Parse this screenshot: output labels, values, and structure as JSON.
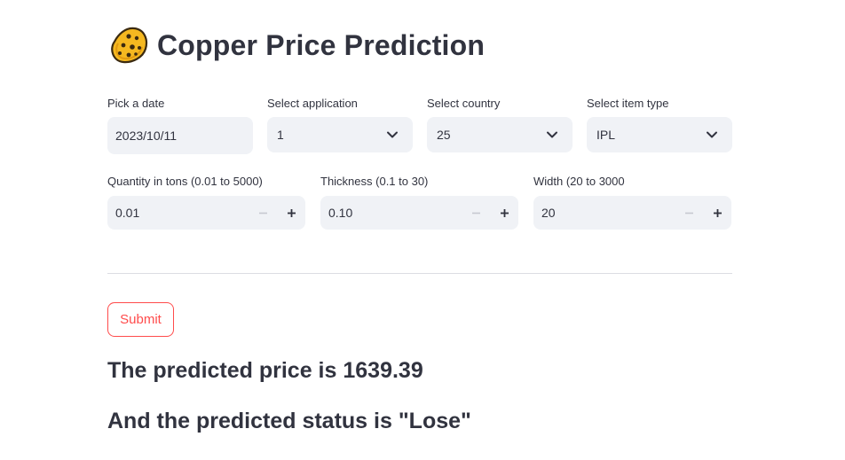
{
  "header": {
    "title": "Copper Price Prediction",
    "icon": "sponge-icon"
  },
  "form": {
    "date": {
      "label": "Pick a date",
      "value": "2023/10/11"
    },
    "application": {
      "label": "Select application",
      "value": "1"
    },
    "country": {
      "label": "Select country",
      "value": "25"
    },
    "item_type": {
      "label": "Select item type",
      "value": "IPL"
    },
    "quantity": {
      "label": "Quantity in tons (0.01 to 5000)",
      "value": "0.01"
    },
    "thickness": {
      "label": "Thickness (0.1 to 30)",
      "value": "0.10"
    },
    "width": {
      "label": "Width (20 to 3000",
      "value": "20"
    }
  },
  "actions": {
    "submit_label": "Submit"
  },
  "results": {
    "price_text": "The predicted price is 1639.39",
    "status_text": "And the predicted status is \"Lose\""
  },
  "colors": {
    "accent": "#ff4b4b",
    "text": "#31333f",
    "input_bg": "#f0f2f6"
  }
}
